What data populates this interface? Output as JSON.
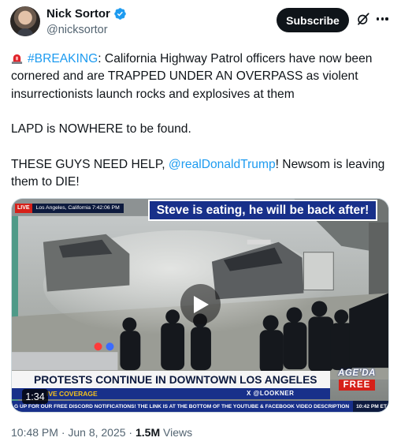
{
  "author": {
    "display_name": "Nick Sortor",
    "handle": "@nicksortor"
  },
  "header": {
    "subscribe_label": "Subscribe",
    "icons": [
      "verified-badge-icon",
      "grok-icon",
      "more-icon"
    ]
  },
  "post": {
    "p1_hashtag": "#BREAKING",
    "p1_text": ": California Highway Patrol officers have now been cornered and are TRAPPED UNDER AN OVERPASS as violent insurrectionists launch rocks and explosives at them",
    "p2_text": "LAPD is NOWHERE to be found.",
    "p3_before": "THESE GUYS NEED HELP, ",
    "p3_mention": "@realDonaldTrump",
    "p3_after": "! Newsom is leaving them to DIE!"
  },
  "media": {
    "live_label": "LIVE",
    "location_time": "Los Angeles, California 7:42:06 PM",
    "overlay_banner": "Steve is eating, he will be back after!",
    "headline": "PROTESTS CONTINUE IN DOWNTOWN LOS ANGELES",
    "sub_left": "IVE COVERAGE",
    "sub_right": "X @LOOKNER",
    "ticker": "G UP FOR OUR FREE DISCORD NOTIFICATIONS! THE LINK IS AT THE BOTTOM OF THE YOUTUBE & FACEBOOK VIDEO DESCRIPTION",
    "ticker_time": "10:42 PM ET",
    "logo_top": "AGE’DA",
    "logo_bottom": "FREE",
    "duration": "1:34"
  },
  "meta": {
    "timestamp": "10:48 PM · Jun 8, 2025 · ",
    "views_count": "1.5M",
    "views_label": " Views"
  },
  "colors": {
    "link": "#1d9bf0",
    "text": "#0f1419",
    "secondary": "#536471",
    "verified": "#1d9bf0"
  }
}
